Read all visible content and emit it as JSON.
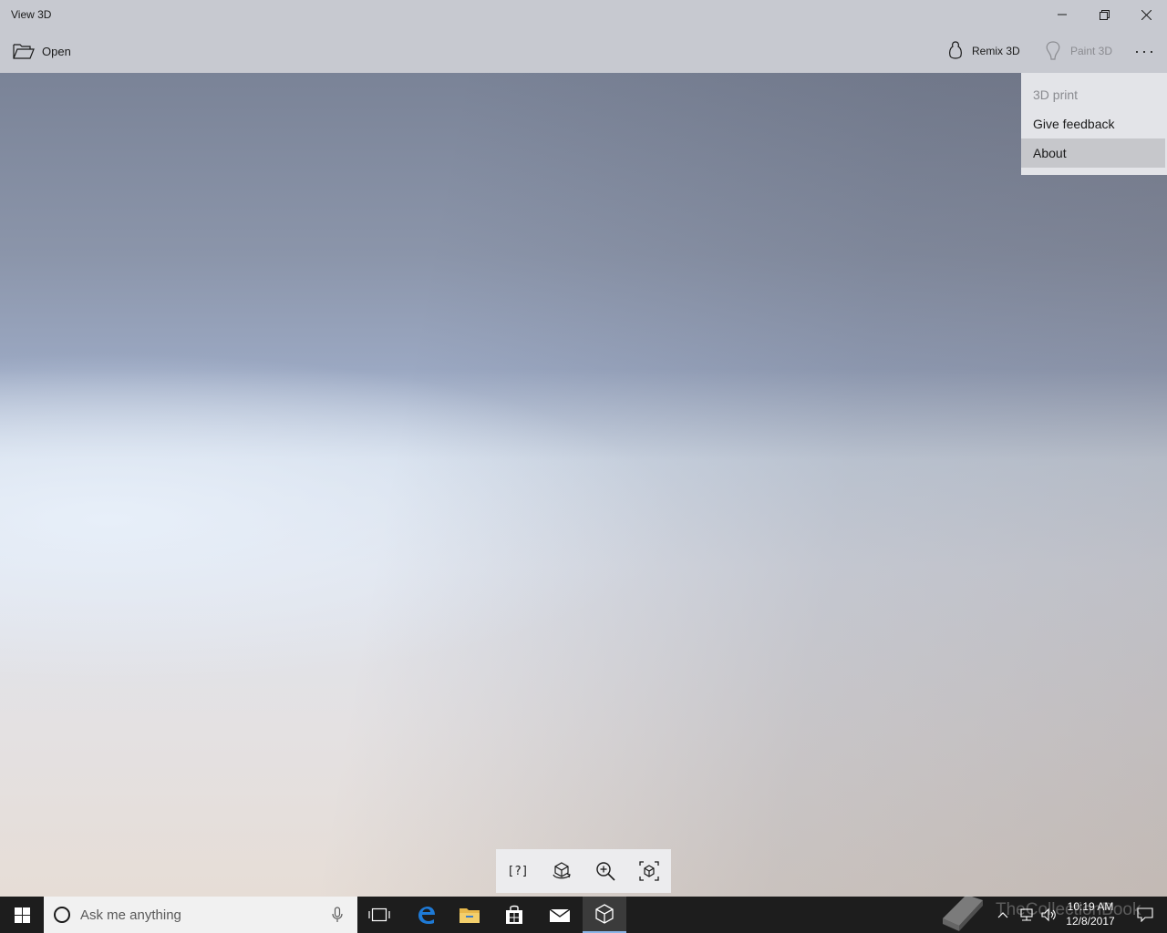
{
  "window": {
    "title": "View 3D",
    "controls": {
      "minimize": "minimize-icon",
      "restore": "restore-icon",
      "close": "close-icon"
    }
  },
  "toolbar": {
    "open_label": "Open",
    "remix_label": "Remix 3D",
    "paint_label": "Paint 3D",
    "more_label": "···"
  },
  "menu": {
    "items": [
      {
        "label": "3D print",
        "state": "disabled"
      },
      {
        "label": "Give feedback",
        "state": "normal"
      },
      {
        "label": "About",
        "state": "hover"
      }
    ]
  },
  "tools": [
    {
      "icon": "help-bracket-icon",
      "glyph": "[?]"
    },
    {
      "icon": "rotate-model-icon"
    },
    {
      "icon": "zoom-in-icon"
    },
    {
      "icon": "fit-view-cube-icon"
    }
  ],
  "taskbar": {
    "search_placeholder": "Ask me anything",
    "time": "10:19 AM",
    "date": "12/8/2017",
    "watermark": "TheCollectionBook"
  },
  "colors": {
    "chrome": "#c7c9d0",
    "menu_bg": "#e3e4e8",
    "menu_hover": "#c6c7cb",
    "taskbar": "#1d1d1d",
    "accent": "#0078d7"
  }
}
